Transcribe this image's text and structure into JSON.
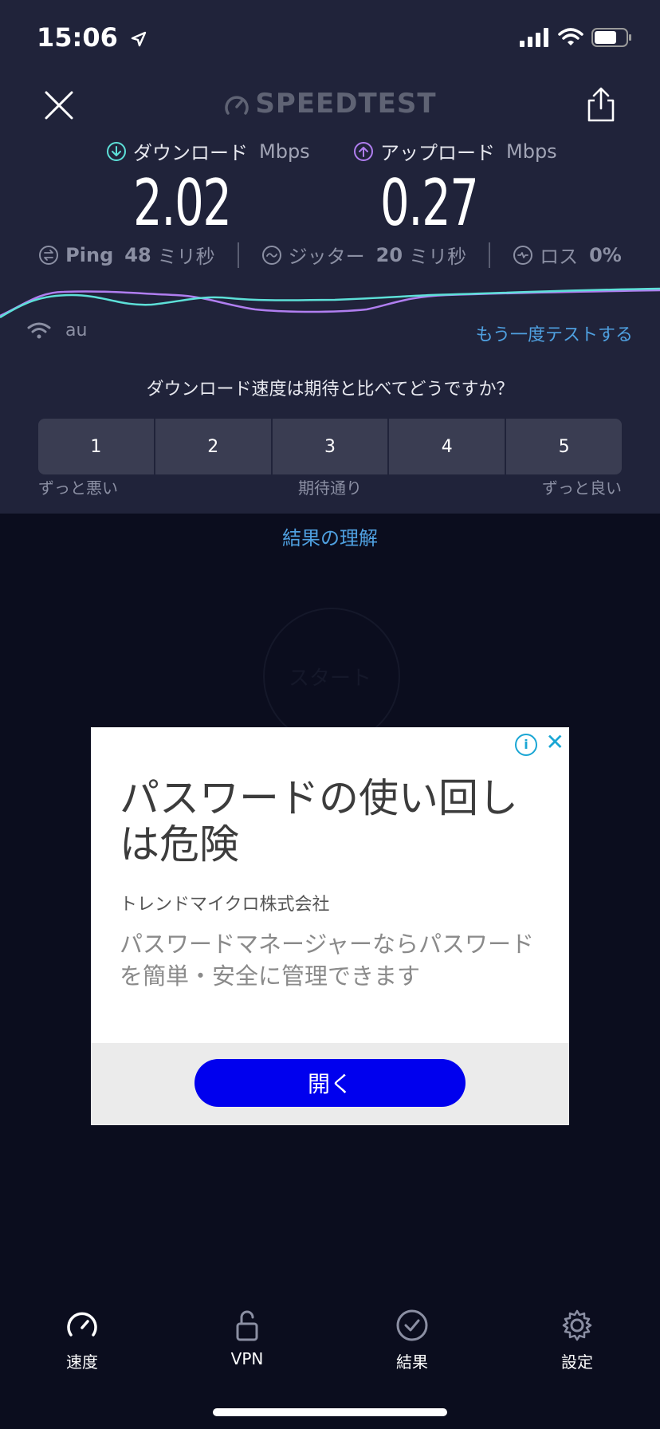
{
  "status_bar": {
    "time": "15:06"
  },
  "header": {
    "brand": "SPEEDTEST"
  },
  "download": {
    "label": "ダウンロード",
    "unit": "Mbps",
    "value": "2.02"
  },
  "upload": {
    "label": "アップロード",
    "unit": "Mbps",
    "value": "0.27"
  },
  "stats": {
    "ping": {
      "label": "Ping",
      "value": "48",
      "unit": "ミリ秒"
    },
    "jitter": {
      "label": "ジッター",
      "value": "20",
      "unit": "ミリ秒"
    },
    "loss": {
      "label": "ロス",
      "value": "0%"
    }
  },
  "network": {
    "name": "au",
    "retest_label": "もう一度テストする"
  },
  "rating": {
    "question": "ダウンロード速度は期待と比べてどうですか？",
    "options": [
      "1",
      "2",
      "3",
      "4",
      "5"
    ],
    "low_label": "ずっと悪い",
    "mid_label": "期待通り",
    "high_label": "ずっと良い"
  },
  "understand_label": "結果の理解",
  "start_label": "スタート",
  "ad": {
    "title": "パスワードの使い回しは危険",
    "advertiser": "トレンドマイクロ株式会社",
    "description": "パスワードマネージャーならパスワードを簡単・安全に管理できます",
    "cta": "開く"
  },
  "tabs": [
    {
      "label": "速度",
      "icon": "speedometer-icon"
    },
    {
      "label": "VPN",
      "icon": "lock-icon"
    },
    {
      "label": "結果",
      "icon": "check-circle-icon"
    },
    {
      "label": "設定",
      "icon": "gear-icon"
    }
  ],
  "colors": {
    "download_accent": "#5de0d8",
    "upload_accent": "#b07ef0",
    "link": "#4fa0e0",
    "ad_cta": "#0000ee"
  }
}
